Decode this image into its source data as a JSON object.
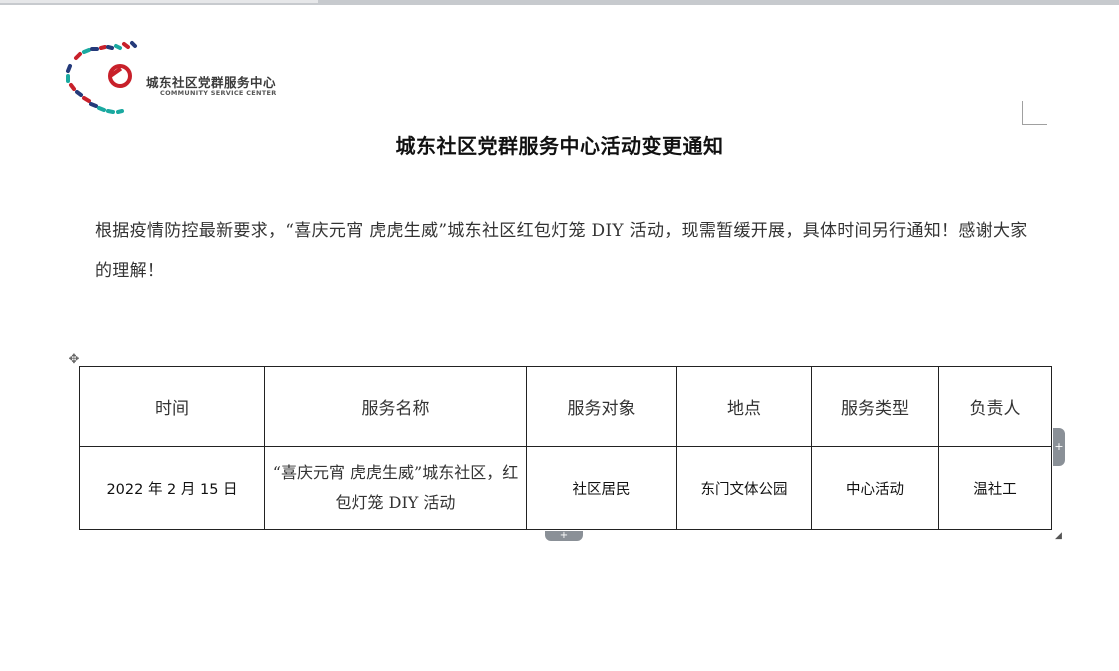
{
  "logo": {
    "name": "城东社区党群服务中心",
    "subtitle": "COMMUNITY SERVICE CENTER",
    "icon": "people-ring-party-emblem-logo"
  },
  "document": {
    "title": "城东社区党群服务中心活动变更通知",
    "paragraph": "根据疫情防控最新要求，“喜庆元宵 虎虎生威”城东社区红包灯笼 DIY 活动，现需暂缓开展，具体时间另行通知！感谢大家的理解！"
  },
  "table": {
    "headers": [
      "时间",
      "服务名称",
      "服务对象",
      "地点",
      "服务类型",
      "负责人"
    ],
    "rows": [
      [
        "2022 年 2 月 15 日",
        "“喜庆元宵 虎虎生威”城东社区，红包灯笼 DIY 活动",
        "社区居民",
        "东门文体公园",
        "中心活动",
        "温社工"
      ]
    ]
  },
  "controls": {
    "move_icon": "move-icon",
    "add_column_icon": "plus-icon",
    "add_row_icon": "plus-icon",
    "resize_icon": "resize-icon"
  },
  "colors": {
    "accent_red": "#c8202a",
    "accent_navy": "#243a7a",
    "accent_teal": "#1aa9a0"
  }
}
